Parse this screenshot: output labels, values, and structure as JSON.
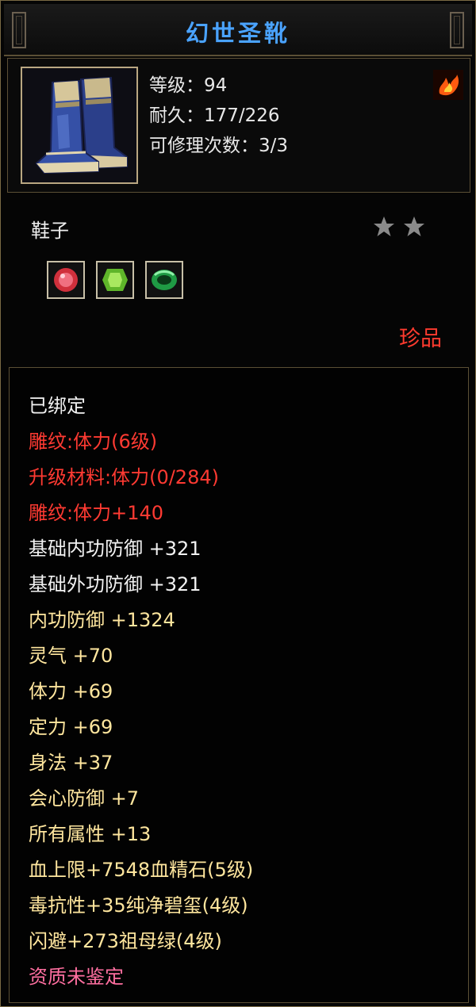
{
  "item": {
    "name": "幻世圣靴",
    "level_line": "等级：94",
    "durability_line": "耐久：177/226",
    "repair_line": "可修理次数：3/3",
    "type": "鞋子",
    "stars": 2,
    "rarity": "珍品",
    "gems": [
      {
        "name": "血精石",
        "color": "#c8303a"
      },
      {
        "name": "纯净碧玺",
        "color": "#7bd13a"
      },
      {
        "name": "祖母绿",
        "color": "#2fbf5a"
      }
    ]
  },
  "attributes": [
    {
      "text": "已绑定",
      "color": "white"
    },
    {
      "text": "雕纹:体力(6级)",
      "color": "red"
    },
    {
      "text": "升级材料:体力(0/284)",
      "color": "red"
    },
    {
      "text": "雕纹:体力+140",
      "color": "red"
    },
    {
      "text": "基础内功防御 +321",
      "color": "white"
    },
    {
      "text": "基础外功防御 +321",
      "color": "white"
    },
    {
      "text": "内功防御 +1324",
      "color": "gold"
    },
    {
      "text": "灵气 +70",
      "color": "gold"
    },
    {
      "text": "体力 +69",
      "color": "gold"
    },
    {
      "text": "定力 +69",
      "color": "gold"
    },
    {
      "text": "身法 +37",
      "color": "gold"
    },
    {
      "text": "会心防御 +7",
      "color": "gold"
    },
    {
      "text": "所有属性 +13",
      "color": "gold"
    },
    {
      "text": "血上限+7548血精石(5级)",
      "color": "gold"
    },
    {
      "text": "毒抗性+35纯净碧玺(4级)",
      "color": "gold"
    },
    {
      "text": "闪避+273祖母绿(4级)",
      "color": "gold"
    },
    {
      "text": "资质未鉴定",
      "color": "pink"
    }
  ],
  "colors": {
    "title": "#4aa3ff",
    "white": "#f2f2f2",
    "red": "#ff3a32",
    "gold": "#ffe69e",
    "pink": "#ff6fa0",
    "border": "#5b4f35"
  }
}
